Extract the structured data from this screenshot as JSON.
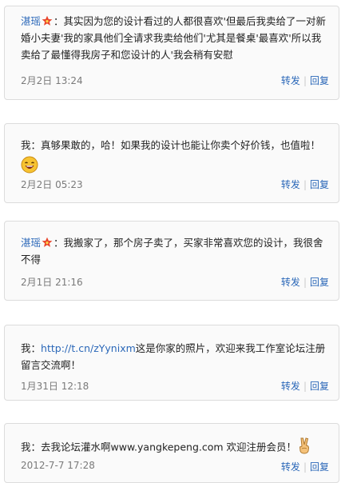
{
  "comments": [
    {
      "author": "湛瑶",
      "colon": "：",
      "text": "其实因为您的设计看过的人都很喜欢'但最后我卖给了一对新婚小夫妻'我的家具他们全请求我卖给他们'尤其是餐桌'最喜欢'所以我卖给了最懂得我房子和您设计的人'我会稍有安慰",
      "time": "2月2日 13:24",
      "repost": "转发",
      "reply": "回复"
    },
    {
      "author": "我",
      "colon": "：",
      "text": "真够果敢的，哈！如果我的设计也能让你卖个好价钱，也值啦！",
      "emoji": "laugh-emoji",
      "time": "2月2日 05:23",
      "repost": "转发",
      "reply": "回复"
    },
    {
      "author": "湛瑶",
      "colon": "：",
      "text": "我搬家了，那个房子卖了，买家非常喜欢您的设计，我很舍不得",
      "time": "2月1日 21:16",
      "repost": "转发",
      "reply": "回复"
    },
    {
      "author": "我",
      "colon": "：",
      "link": "http://t.cn/zYynixm",
      "text": "这是你家的照片，欢迎来我工作室论坛注册留言交流啊！",
      "time": "1月31日 12:18",
      "repost": "转发",
      "reply": "回复"
    },
    {
      "author": "我",
      "colon": "：",
      "text": "去我论坛灌水啊www.yangkepeng.com 欢迎注册会员！",
      "emoji": "victory-hand-emoji",
      "time": "2012-7-7 17:28",
      "repost": "转发",
      "reply": "回复"
    }
  ],
  "colors": {
    "link": "#2a67b8",
    "time": "#7a7a7a",
    "border": "#dcdcdc"
  },
  "icons": {
    "vip_badge": "star-badge-icon"
  }
}
